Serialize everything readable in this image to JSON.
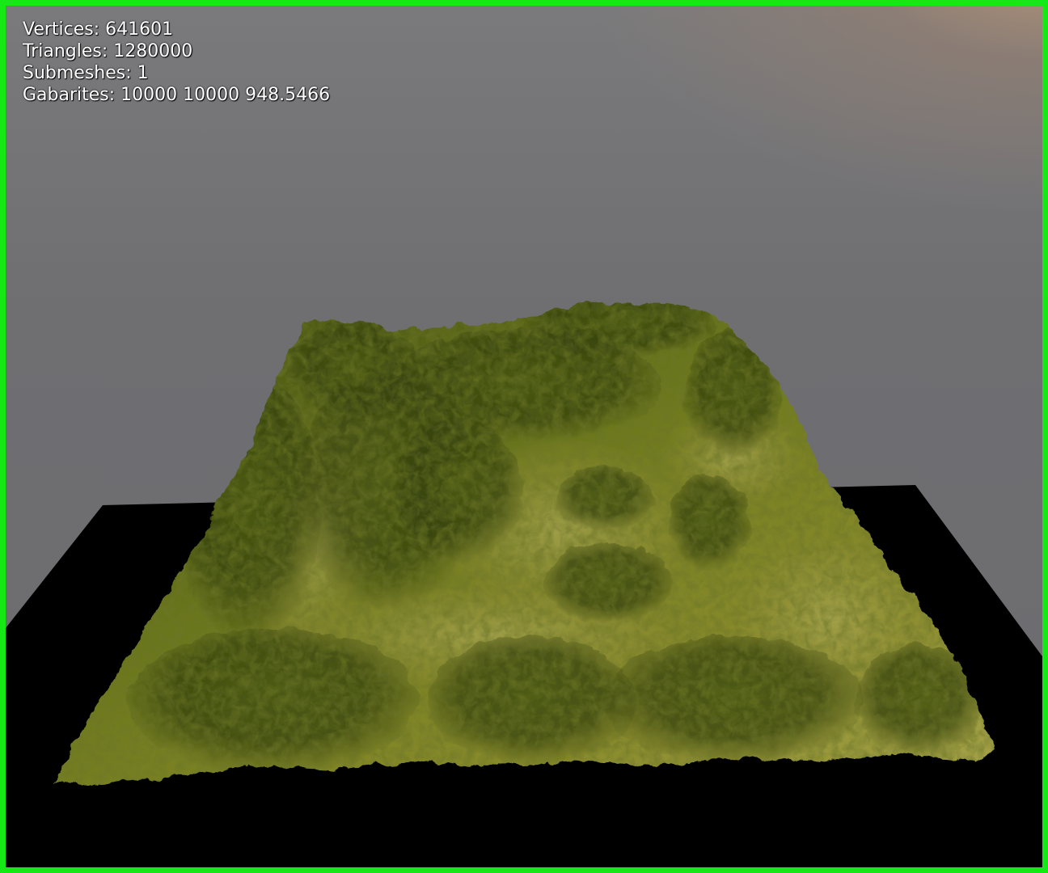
{
  "window": {
    "frame_color": "#15e815",
    "sky_color": "#6f6f72",
    "horizon_glow_color": "#c49c78",
    "ground_color": "#000000",
    "terrain_base_color": "#6f7a1e",
    "terrain_highlight_color": "#c9c66a",
    "terrain_shadow_color": "#1f2a08"
  },
  "stats": {
    "vertices_label": "Vertices:",
    "vertices_value": "641601",
    "triangles_label": "Triangles:",
    "triangles_value": "1280000",
    "submeshes_label": "Submeshes:",
    "submeshes_value": "1",
    "gabarites_label": "Gabarites:",
    "gabarites_value": "10000 10000 948.5466"
  }
}
